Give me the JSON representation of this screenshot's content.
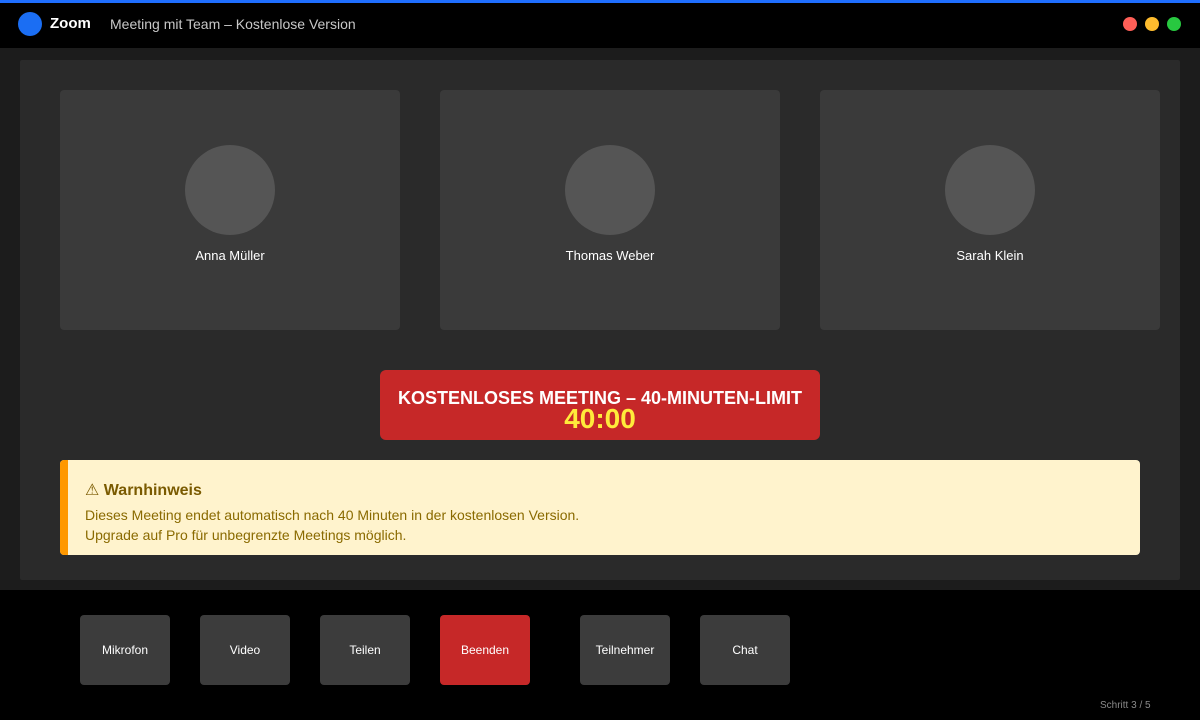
{
  "app": {
    "name": "Zoom",
    "window_title": "Meeting mit Team – Kostenlose Version",
    "accent_color": "#1b6ef3"
  },
  "window_controls": {
    "icons": [
      "close-icon",
      "minimize-icon",
      "maximize-icon"
    ]
  },
  "participants": [
    {
      "name": "Anna Müller"
    },
    {
      "name": "Thomas Weber"
    },
    {
      "name": "Sarah Klein"
    }
  ],
  "limit_banner": {
    "title": "KOSTENLOSES MEETING – 40-MINUTEN-LIMIT",
    "timer": "40:00",
    "color": "#c62828",
    "timer_color": "#ffeb3b"
  },
  "warning": {
    "icon": "⚠",
    "icon_name": "warning-icon",
    "title": "Warnhinweis",
    "line1": "Dieses Meeting endet automatisch nach 40 Minuten in der kostenlosen Version.",
    "line2": "Upgrade auf Pro für unbegrenzte Meetings möglich.",
    "background_color": "#fff3cd",
    "accent_color": "#ff9800"
  },
  "toolbar": {
    "mic_label": "Mikrofon",
    "video_label": "Video",
    "share_label": "Teilen",
    "end_label": "Beenden",
    "participants_label": "Teilnehmer",
    "chat_label": "Chat",
    "end_color": "#c62828"
  },
  "step_indicator": "Schritt 3 / 5"
}
